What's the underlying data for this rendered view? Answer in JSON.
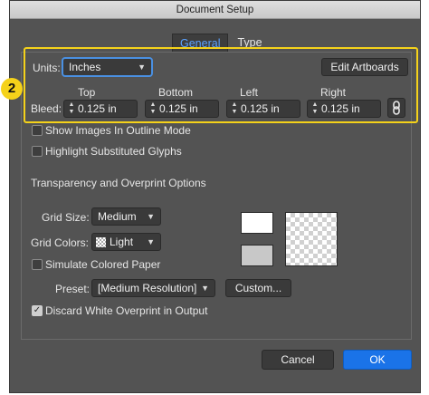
{
  "window": {
    "title": "Document Setup"
  },
  "tabs": [
    {
      "label": "General",
      "active": true
    },
    {
      "label": "Type",
      "active": false
    }
  ],
  "callout_number": "2",
  "units": {
    "label": "Units:",
    "value": "Inches"
  },
  "edit_artboards_label": "Edit Artboards",
  "bleed": {
    "label": "Bleed:",
    "headers": [
      "Top",
      "Bottom",
      "Left",
      "Right"
    ],
    "values": [
      "0.125 in",
      "0.125 in",
      "0.125 in",
      "0.125 in"
    ]
  },
  "checkboxes": {
    "outline_mode": {
      "label": "Show Images In Outline Mode",
      "checked": false
    },
    "substituted_glyphs": {
      "label": "Highlight Substituted Glyphs",
      "checked": false
    },
    "simulate_paper": {
      "label": "Simulate Colored Paper",
      "checked": false
    },
    "discard_overprint": {
      "label": "Discard White Overprint in Output",
      "checked": true
    }
  },
  "transparency": {
    "title": "Transparency and Overprint Options",
    "grid_size": {
      "label": "Grid Size:",
      "value": "Medium"
    },
    "grid_colors": {
      "label": "Grid Colors:",
      "value": "Light"
    },
    "preset": {
      "label": "Preset:",
      "value": "[Medium Resolution]"
    },
    "custom_label": "Custom..."
  },
  "buttons": {
    "cancel": "Cancel",
    "ok": "OK"
  },
  "colors": {
    "accent": "#5aa2ff",
    "callout": "#f5d21a",
    "ok_button": "#1a73e8",
    "panel_bg": "#535353"
  }
}
